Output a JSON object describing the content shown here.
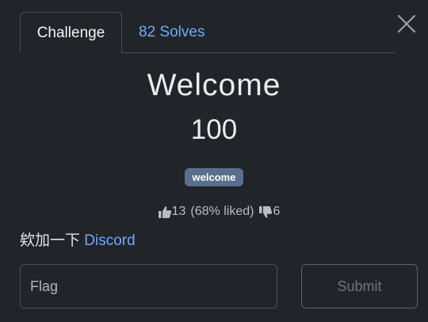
{
  "tabs": [
    {
      "label": "Challenge",
      "active": true
    },
    {
      "label": "82 Solves",
      "active": false
    }
  ],
  "challenge": {
    "title": "Welcome",
    "points": "100",
    "tag": "welcome",
    "likes": "13",
    "liked_pct": "(68% liked)",
    "dislikes": "6",
    "description_text": "欸加一下",
    "description_link": "Discord"
  },
  "form": {
    "flag_placeholder": "Flag",
    "flag_value": "",
    "submit_label": "Submit"
  },
  "icons": {
    "close": "close-icon",
    "like": "thumbs-up-icon",
    "dislike": "thumbs-down-icon"
  },
  "colors": {
    "background": "#212529",
    "link": "#6ea8fe",
    "tag_bg": "#5a6f8e"
  }
}
